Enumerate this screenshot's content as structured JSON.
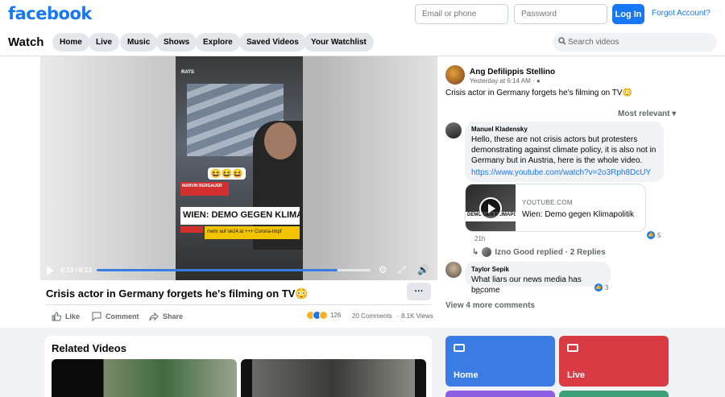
{
  "header": {
    "logo": "facebook",
    "email_placeholder": "Email or phone",
    "password_placeholder": "Password",
    "login_label": "Log In",
    "forgot_label": "Forgot Account?"
  },
  "watch_nav": {
    "title": "Watch",
    "tabs": [
      "Home",
      "Live",
      "Music",
      "Shows",
      "Explore",
      "Saved Videos",
      "Your Watchlist"
    ],
    "search_placeholder": "Search videos"
  },
  "video": {
    "time": "0:13 / 0:13",
    "progress": 0.88,
    "title": "Crisis actor in Germany forgets he's filming on TV😳",
    "overlay_emoji": "😆😆😆",
    "frame_logo": "RATS",
    "frame_nameplate": "MARVIN BERGAUER",
    "frame_headline": "WIEN: DEMO GEGEN KLIMAP",
    "frame_ticker": "mehr auf oe24.at +++ Corona-Impf",
    "more_label": "···",
    "actions": {
      "like": "Like",
      "comment": "Comment",
      "share": "Share"
    },
    "reaction_count": "126",
    "comments_count": "20 Comments",
    "views": "8.1K Views"
  },
  "post": {
    "author": "Ang Defilippis Stellino",
    "meta": "Yesterday at 6:14 AM ·",
    "text": "Crisis actor in Germany forgets he's filming on TV😳",
    "sort_label": "Most relevant"
  },
  "comments": [
    {
      "name": "Manuel Kladensky",
      "text": "Hello, these are not crisis actors but protesters demonstrating against climate policy, it is also not in Germany but in Austria, here is the whole video.",
      "link": "https://www.youtube.com/watch?v=2o3Rph8DcUY",
      "card_source": "YOUTUBE.COM",
      "card_title": "Wien: Demo gegen Klimapolitik",
      "card_thumb_text": "DEMO GEN KLIMAPOLITIK",
      "age": "21h",
      "likes": "5",
      "reply_text": "Izno Good replied · 2 Replies"
    },
    {
      "name": "Taylor Sepik",
      "text": "What liars our news media has become",
      "age": "1d",
      "likes": "3"
    }
  ],
  "view_more": "View 4 more comments",
  "related": {
    "title": "Related Videos"
  },
  "tiles": [
    {
      "label": "Home",
      "color": "#3b7be4"
    },
    {
      "label": "Live",
      "color": "#d83b44"
    }
  ]
}
